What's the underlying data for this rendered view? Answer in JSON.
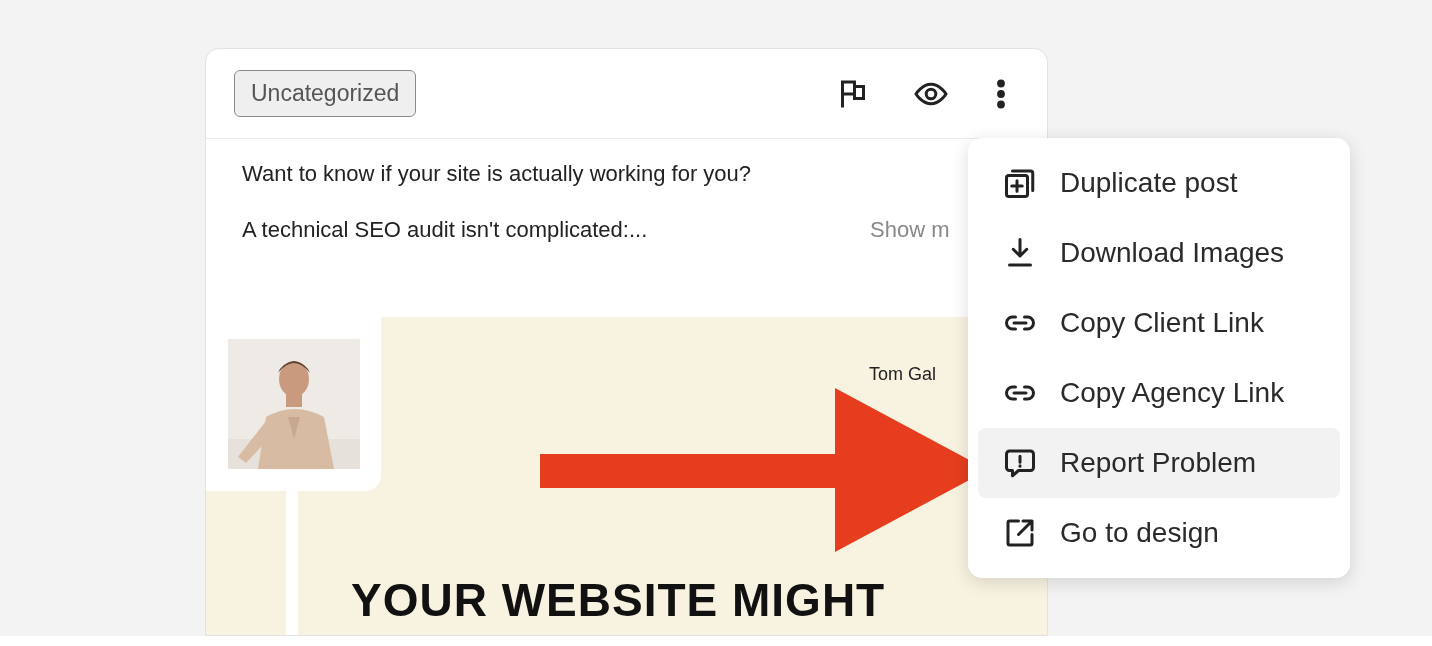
{
  "post": {
    "category": "Uncategorized",
    "caption": [
      "Want to know if your site is actually working for you?",
      "A technical SEO audit isn't complicated:..."
    ],
    "show_more": "Show m",
    "design": {
      "author": "Tom Gal",
      "headline": "YOUR WEBSITE MIGHT"
    }
  },
  "menu": {
    "items": [
      {
        "label": "Duplicate post",
        "kind": "duplicate",
        "selected": false
      },
      {
        "label": "Download Images",
        "kind": "download",
        "selected": false
      },
      {
        "label": "Copy Client Link",
        "kind": "link",
        "selected": false
      },
      {
        "label": "Copy Agency Link",
        "kind": "link",
        "selected": false
      },
      {
        "label": "Report Problem",
        "kind": "report",
        "selected": true
      },
      {
        "label": "Go to design",
        "kind": "external",
        "selected": false
      }
    ]
  }
}
